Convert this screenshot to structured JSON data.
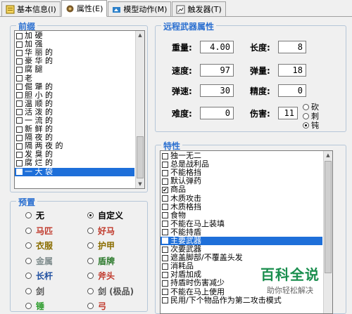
{
  "tabs": [
    {
      "label": "基本信息(I)",
      "icon": "info-icon",
      "active": false
    },
    {
      "label": "属性(E)",
      "icon": "attributes-icon",
      "active": true
    },
    {
      "label": "模型动作(M)",
      "icon": "model-action-icon",
      "active": false
    },
    {
      "label": "触发器(T)",
      "icon": "trigger-icon",
      "active": false
    }
  ],
  "prefix": {
    "title": "前缀",
    "items": [
      {
        "label": "加 硬",
        "checked": false,
        "selected": false
      },
      {
        "label": "加 强",
        "checked": false,
        "selected": false
      },
      {
        "label": "华 丽 的",
        "checked": false,
        "selected": false
      },
      {
        "label": "豪 华 的",
        "checked": false,
        "selected": false
      },
      {
        "label": "腐 腿",
        "checked": false,
        "selected": false
      },
      {
        "label": "老",
        "checked": false,
        "selected": false
      },
      {
        "label": "倔 犟 的",
        "checked": false,
        "selected": false
      },
      {
        "label": "胆 小 的",
        "checked": false,
        "selected": false
      },
      {
        "label": "温 顺 的",
        "checked": false,
        "selected": false
      },
      {
        "label": "活 泼 的",
        "checked": false,
        "selected": false
      },
      {
        "label": "一 流 的",
        "checked": false,
        "selected": false
      },
      {
        "label": "新 鲜 的",
        "checked": false,
        "selected": false
      },
      {
        "label": "隔 夜 的",
        "checked": false,
        "selected": false
      },
      {
        "label": "隔 两 夜 的",
        "checked": false,
        "selected": false
      },
      {
        "label": "发 臭 的",
        "checked": false,
        "selected": false
      },
      {
        "label": "腐 烂 的",
        "checked": false,
        "selected": false
      },
      {
        "label": "一 大 袋",
        "checked": true,
        "selected": true
      }
    ]
  },
  "presets": {
    "title": "预置",
    "options": [
      {
        "label": "无",
        "color": "#000000",
        "checked": false
      },
      {
        "label": "自定义",
        "color": "#000000",
        "checked": true
      },
      {
        "label": "马匹",
        "color": "#c0392b",
        "checked": false
      },
      {
        "label": "好马",
        "color": "#c0392b",
        "checked": false
      },
      {
        "label": "衣服",
        "color": "#8a6d00",
        "checked": false
      },
      {
        "label": "护甲",
        "color": "#8a6d00",
        "checked": false
      },
      {
        "label": "金属",
        "color": "#7f8c8d",
        "checked": false
      },
      {
        "label": "盾牌",
        "color": "#2c7a2c",
        "checked": false
      },
      {
        "label": "长杆",
        "color": "#1f4fa0",
        "checked": false
      },
      {
        "label": "斧头",
        "color": "#c0392b",
        "checked": false
      },
      {
        "label": "剑",
        "color": "#555555",
        "checked": false
      },
      {
        "label": "剑 (极品)",
        "color": "#555555",
        "checked": false
      },
      {
        "label": "锤",
        "color": "#2c9c2c",
        "checked": false
      },
      {
        "label": "弓",
        "color": "#c0392b",
        "checked": false
      }
    ]
  },
  "ranged": {
    "title": "远程武器属性",
    "fields": [
      {
        "label": "重量:",
        "value": "4.00"
      },
      {
        "label": "长度:",
        "value": "8"
      },
      {
        "label": "速度:",
        "value": "97"
      },
      {
        "label": "弹量:",
        "value": "18"
      },
      {
        "label": "弹速:",
        "value": "30"
      },
      {
        "label": "精度:",
        "value": "0"
      },
      {
        "label": "难度:",
        "value": "0"
      },
      {
        "label": "伤害:",
        "value": "11"
      }
    ],
    "damage_types": [
      {
        "label": "砍",
        "checked": false
      },
      {
        "label": "刺",
        "checked": false
      },
      {
        "label": "钝",
        "checked": true
      }
    ]
  },
  "traits": {
    "title": "特性",
    "items": [
      {
        "label": "独一无二",
        "checked": false,
        "selected": false
      },
      {
        "label": "总是战利品",
        "checked": false,
        "selected": false
      },
      {
        "label": "不能格挡",
        "checked": false,
        "selected": false
      },
      {
        "label": "默认弹药",
        "checked": false,
        "selected": false
      },
      {
        "label": "商品",
        "checked": true,
        "selected": false
      },
      {
        "label": "木质攻击",
        "checked": false,
        "selected": false
      },
      {
        "label": "木质格挡",
        "checked": false,
        "selected": false
      },
      {
        "label": "食物",
        "checked": false,
        "selected": false
      },
      {
        "label": "不能在马上装填",
        "checked": false,
        "selected": false
      },
      {
        "label": "不能持盾",
        "checked": false,
        "selected": false
      },
      {
        "label": "主要武器",
        "checked": true,
        "selected": true
      },
      {
        "label": "次要武器",
        "checked": false,
        "selected": false
      },
      {
        "label": "遮盖脚部/不覆盖头发",
        "checked": false,
        "selected": false
      },
      {
        "label": "消耗品",
        "checked": false,
        "selected": false
      },
      {
        "label": "对盾加成",
        "checked": false,
        "selected": false
      },
      {
        "label": "持盾时伤害减少",
        "checked": false,
        "selected": false
      },
      {
        "label": "不能在马上使用",
        "checked": false,
        "selected": false
      },
      {
        "label": "民用/下个物品作为第二攻击模式",
        "checked": false,
        "selected": false
      }
    ]
  },
  "watermark": {
    "title": "百科全说",
    "subtitle": "助你轻松解决"
  }
}
